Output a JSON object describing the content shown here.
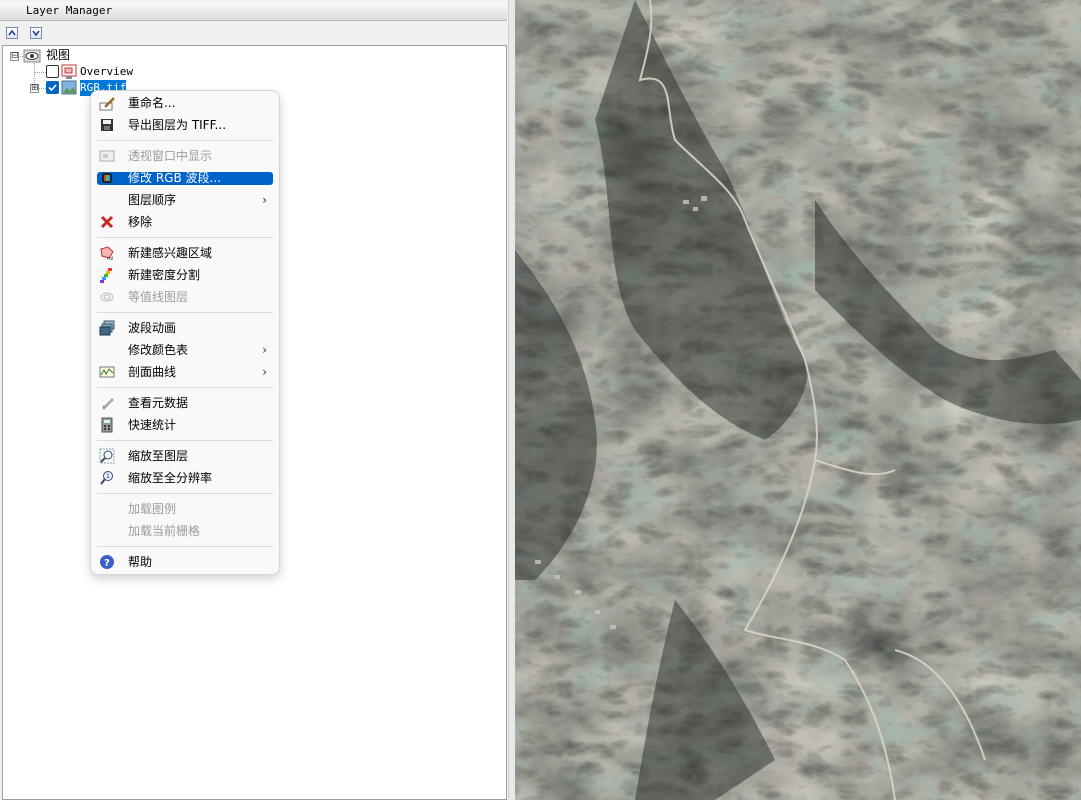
{
  "panel": {
    "title": "Layer Manager"
  },
  "toolbar": {
    "up_icon": "arrow-up-icon",
    "down_icon": "arrow-down-icon"
  },
  "tree": {
    "root": {
      "label": "视图",
      "expander": "⊟"
    },
    "overview": {
      "label": "Overview",
      "checked": false
    },
    "rgb": {
      "label": "RGB.tif",
      "checked": true,
      "expander": "⊞"
    }
  },
  "context_menu": {
    "items": [
      {
        "label": "重命名...",
        "icon": "rename-icon",
        "enabled": true
      },
      {
        "label": "导出图层为 TIFF...",
        "icon": "save-icon",
        "enabled": true
      },
      {
        "label": "透视窗口中显示",
        "icon": "portal-icon",
        "enabled": false
      },
      {
        "label": "修改 RGB 波段...",
        "icon": "rgb-bands-icon",
        "enabled": true,
        "highlighted": true
      },
      {
        "label": "图层顺序",
        "icon": "",
        "enabled": true,
        "submenu": true
      },
      {
        "label": "移除",
        "icon": "remove-icon",
        "enabled": true
      },
      {
        "label": "新建感兴趣区域",
        "icon": "roi-icon",
        "enabled": true
      },
      {
        "label": "新建密度分割",
        "icon": "density-slice-icon",
        "enabled": true
      },
      {
        "label": "等值线图层",
        "icon": "contour-icon",
        "enabled": false
      },
      {
        "label": "波段动画",
        "icon": "band-animation-icon",
        "enabled": true
      },
      {
        "label": "修改颜色表",
        "icon": "",
        "enabled": true,
        "submenu": true
      },
      {
        "label": "剖面曲线",
        "icon": "profile-icon",
        "enabled": true,
        "submenu": true
      },
      {
        "label": "查看元数据",
        "icon": "metadata-icon",
        "enabled": true
      },
      {
        "label": "快速统计",
        "icon": "statistics-icon",
        "enabled": true
      },
      {
        "label": "缩放至图层",
        "icon": "zoom-layer-icon",
        "enabled": true
      },
      {
        "label": "缩放至全分辨率",
        "icon": "zoom-full-icon",
        "enabled": true
      },
      {
        "label": "加载图例",
        "icon": "",
        "enabled": false
      },
      {
        "label": "加载当前栅格",
        "icon": "",
        "enabled": false
      },
      {
        "label": "帮助",
        "icon": "help-icon",
        "enabled": true
      }
    ],
    "submenu_arrow": "›"
  },
  "map": {
    "type": "satellite imagery",
    "colors": {
      "terrain_dark": "#3a3a36",
      "terrain_mid": "#6b6659",
      "field_green": "#5f7a6c",
      "road": "#d8d4c8"
    }
  }
}
